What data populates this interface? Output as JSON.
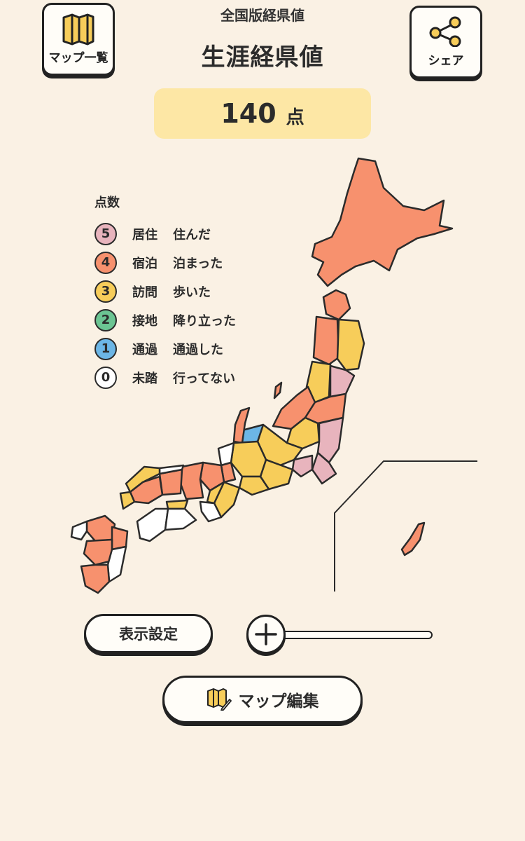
{
  "header": {
    "subtitle": "全国版経県値",
    "title": "生涯経県値",
    "map_list_label": "マップ一覧",
    "share_label": "シェア"
  },
  "score": {
    "value": "140",
    "unit": "点"
  },
  "legend": {
    "title": "点数",
    "items": [
      {
        "num": "5",
        "label": "居住",
        "desc": "住んだ",
        "color": "#e8b4bd"
      },
      {
        "num": "4",
        "label": "宿泊",
        "desc": "泊まった",
        "color": "#f7916e"
      },
      {
        "num": "3",
        "label": "訪問",
        "desc": "歩いた",
        "color": "#f7cd5a"
      },
      {
        "num": "2",
        "label": "接地",
        "desc": "降り立った",
        "color": "#6bc593"
      },
      {
        "num": "1",
        "label": "通過",
        "desc": "通過した",
        "color": "#6cb6e6"
      },
      {
        "num": "0",
        "label": "未踏",
        "desc": "行ってない",
        "color": "#ffffff"
      }
    ]
  },
  "controls": {
    "display_settings_label": "表示設定",
    "map_edit_label": "マップ編集",
    "zoom_level": 0
  },
  "colors": {
    "background": "#faf1e4",
    "score_box": "#fde7a5",
    "level_5": "#e8b4bd",
    "level_4": "#f7916e",
    "level_3": "#f7cd5a",
    "level_2": "#6bc593",
    "level_1": "#6cb6e6",
    "level_0": "#ffffff"
  }
}
